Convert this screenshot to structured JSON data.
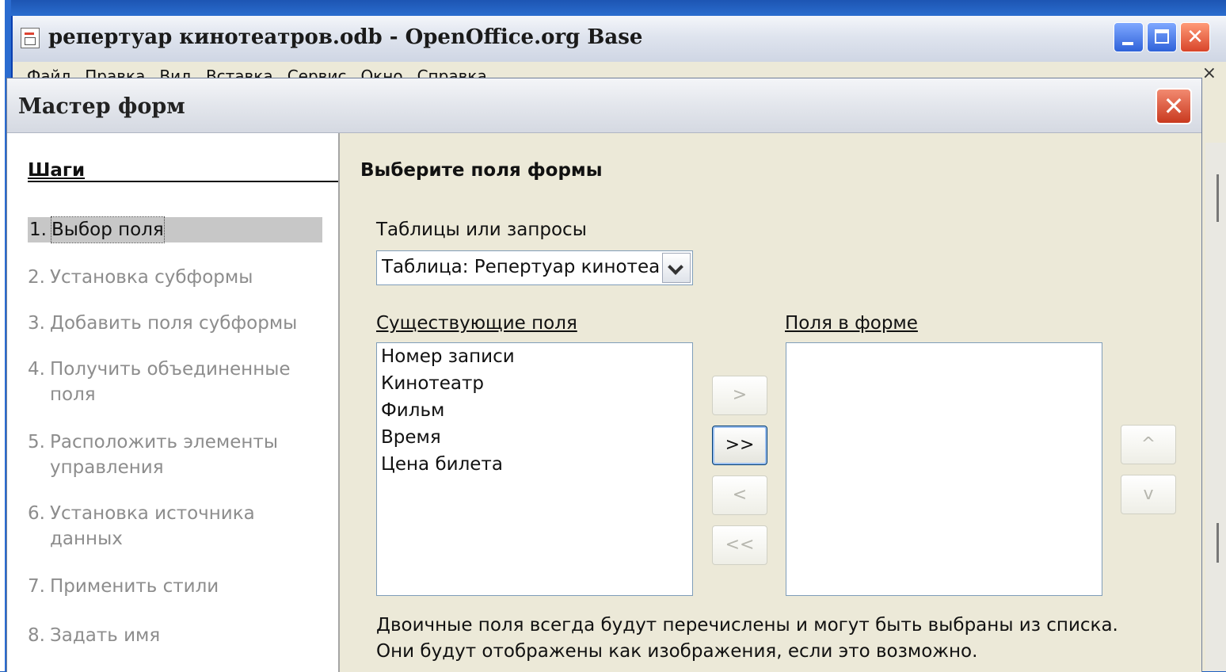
{
  "app": {
    "title": "репертуар кинотеатров.odb - OpenOffice.org Base",
    "menu": [
      "Файл",
      "Правка",
      "Вид",
      "Вставка",
      "Сервис",
      "Окно",
      "Справка"
    ]
  },
  "dialog": {
    "title": "Мастер форм",
    "close_glyph": "✕",
    "steps_heading": "Шаги",
    "steps": [
      {
        "num": "1.",
        "label": "Выбор поля",
        "active": true
      },
      {
        "num": "2.",
        "label": "Установка субформы"
      },
      {
        "num": "3.",
        "label": "Добавить поля субформы"
      },
      {
        "num": "4.",
        "label": "Получить объединенные поля"
      },
      {
        "num": "5.",
        "label": "Расположить элементы управления"
      },
      {
        "num": "6.",
        "label": "Установка источника данных"
      },
      {
        "num": "7.",
        "label": "Применить стили"
      },
      {
        "num": "8.",
        "label": "Задать имя"
      }
    ],
    "content_title": "Выберите поля формы",
    "tables_label": "Таблицы или запросы",
    "tables_value": "Таблица: Репертуар кинотеатров",
    "existing_label": "Существующие поля",
    "existing_fields": [
      "Номер записи",
      "Кинотеатр",
      "Фильм",
      "Время",
      "Цена билета"
    ],
    "form_fields_label": "Поля в форме",
    "form_fields": [],
    "buttons": {
      "add": ">",
      "add_all": ">>",
      "remove": "<",
      "remove_all": "<<",
      "up": "^",
      "down": "v"
    },
    "hint_line1": "Двоичные поля всегда будут перечислены и могут быть выбраны из списка.",
    "hint_line2": "Они будут отображены как изображения, если это возможно."
  },
  "colors": {
    "accent": "#0a3fb0",
    "selected_step": "#c7c7c7",
    "close_button": "#d8452a"
  }
}
